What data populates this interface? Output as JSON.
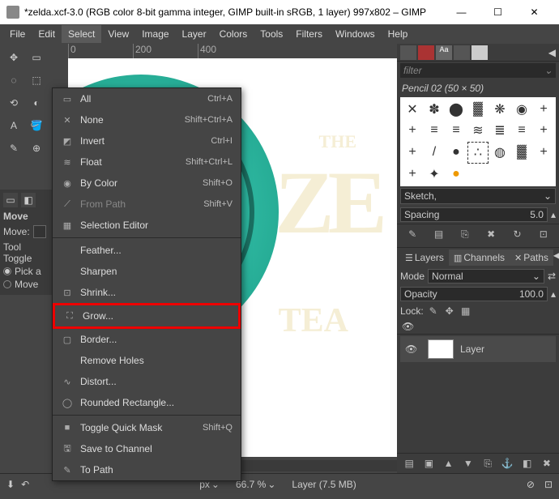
{
  "titlebar": {
    "title": "*zelda.xcf-3.0 (RGB color 8-bit gamma integer, GIMP built-in sRGB, 1 layer) 997x802 – GIMP"
  },
  "menubar": {
    "items": [
      "File",
      "Edit",
      "Select",
      "View",
      "Image",
      "Layer",
      "Colors",
      "Tools",
      "Filters",
      "Windows",
      "Help"
    ],
    "active_index": 2
  },
  "dropdown": {
    "groups": [
      [
        {
          "icon": "▭",
          "label": "All",
          "shortcut": "Ctrl+A",
          "disabled": false
        },
        {
          "icon": "✕",
          "label": "None",
          "shortcut": "Shift+Ctrl+A",
          "disabled": false
        },
        {
          "icon": "◩",
          "label": "Invert",
          "shortcut": "Ctrl+I",
          "disabled": false
        },
        {
          "icon": "≋",
          "label": "Float",
          "shortcut": "Shift+Ctrl+L",
          "disabled": false
        },
        {
          "icon": "◉",
          "label": "By Color",
          "shortcut": "Shift+O",
          "disabled": false
        },
        {
          "icon": "⟋",
          "label": "From Path",
          "shortcut": "Shift+V",
          "disabled": true
        },
        {
          "icon": "▦",
          "label": "Selection Editor",
          "shortcut": "",
          "disabled": false
        }
      ],
      [
        {
          "icon": "",
          "label": "Feather...",
          "shortcut": "",
          "disabled": false
        },
        {
          "icon": "",
          "label": "Sharpen",
          "shortcut": "",
          "disabled": false
        },
        {
          "icon": "⊡",
          "label": "Shrink...",
          "shortcut": "",
          "disabled": false
        },
        {
          "icon": "⛶",
          "label": "Grow...",
          "shortcut": "",
          "disabled": false,
          "highlight": true
        },
        {
          "icon": "▢",
          "label": "Border...",
          "shortcut": "",
          "disabled": false
        },
        {
          "icon": "",
          "label": "Remove Holes",
          "shortcut": "",
          "disabled": false
        },
        {
          "icon": "∿",
          "label": "Distort...",
          "shortcut": "",
          "disabled": false
        },
        {
          "icon": "◯",
          "label": "Rounded Rectangle...",
          "shortcut": "",
          "disabled": false
        }
      ],
      [
        {
          "icon": "■",
          "label": "Toggle Quick Mask",
          "shortcut": "Shift+Q",
          "disabled": false
        },
        {
          "icon": "🖫",
          "label": "Save to Channel",
          "shortcut": "",
          "disabled": false
        },
        {
          "icon": "✎",
          "label": "To Path",
          "shortcut": "",
          "disabled": false
        }
      ]
    ]
  },
  "left_dock": {
    "title": "Move",
    "label": "Move:",
    "toggle_label": "Tool Toggle",
    "opts": [
      "Pick a",
      "Move"
    ],
    "selected": 0
  },
  "ruler": {
    "ticks": [
      "0",
      "200",
      "400"
    ]
  },
  "canvas_text": {
    "the": "THE",
    "ze": "ZE",
    "tea": "TEA"
  },
  "right": {
    "filter_placeholder": "filter",
    "brush_title": "Pencil 02 (50 × 50)",
    "sketch_label": "Sketch,",
    "spacing_label": "Spacing",
    "spacing_value": "5.0",
    "tabs": [
      "Layers",
      "Channels",
      "Paths"
    ],
    "mode_label": "Mode",
    "mode_value": "Normal",
    "opacity_label": "Opacity",
    "opacity_value": "100.0",
    "lock_label": "Lock:",
    "layer_name": "Layer"
  },
  "statusbar": {
    "unit": "px",
    "zoom": "66.7 %",
    "layer_info": "Layer (7.5 MB)"
  }
}
